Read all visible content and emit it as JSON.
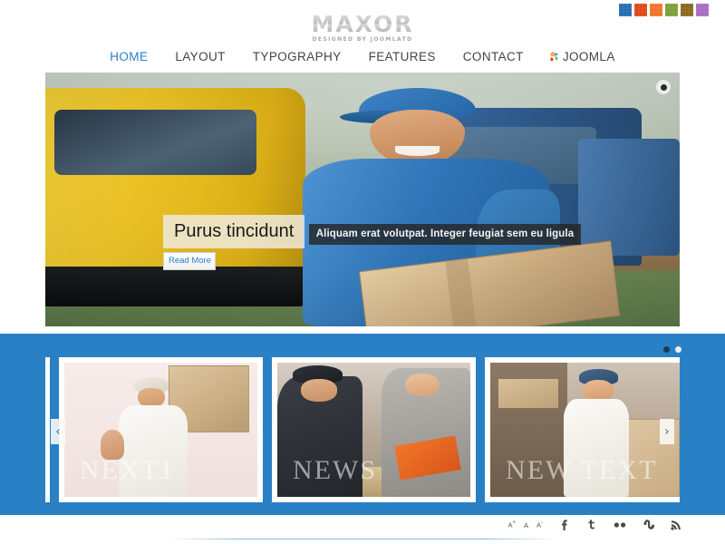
{
  "site": {
    "logo_main": "MAXOR",
    "logo_sub": "DESIGNED BY JOOMLATD"
  },
  "theme_switcher": {
    "name": "color-swatches",
    "colors": [
      "#2a6eb5",
      "#e04a1a",
      "#f2762a",
      "#7ba03c",
      "#8a6a20",
      "#a86ec4"
    ],
    "labels": [
      "blue",
      "red",
      "orange",
      "green",
      "brown",
      "purple"
    ]
  },
  "nav": {
    "items": [
      {
        "label": "HOME",
        "active": true
      },
      {
        "label": "LAYOUT",
        "active": false
      },
      {
        "label": "TYPOGRAPHY",
        "active": false
      },
      {
        "label": "FEATURES",
        "active": false
      },
      {
        "label": "CONTACT",
        "active": false
      },
      {
        "label": "JOOMLA",
        "active": false,
        "icon": "joomla-icon"
      }
    ]
  },
  "slider": {
    "caption_title": "Purus tincidunt",
    "caption_text": "Aliquam erat volutpat. Integer feugiat sem eu ligula",
    "read_more_label": "Read More",
    "play_pause_icon": "pause-dot-icon"
  },
  "carousel": {
    "prev_label": "‹",
    "next_label": "›",
    "pagination": [
      {
        "state": "active"
      },
      {
        "state": "inactive"
      }
    ],
    "items": [
      {
        "name": "thumb-cyclist-courier",
        "watermark": ""
      },
      {
        "name": "thumb-man-with-box",
        "watermark": "NEXT1"
      },
      {
        "name": "thumb-signing-delivery",
        "watermark": "NEWS"
      },
      {
        "name": "thumb-warehouse-worker",
        "watermark": "NEW TEXT"
      }
    ]
  },
  "footer": {
    "font_sizer": [
      {
        "label": "A",
        "sup": "+",
        "name": "font-increase"
      },
      {
        "label": "A",
        "sup": "",
        "name": "font-reset"
      },
      {
        "label": "A",
        "sup": "-",
        "name": "font-decrease"
      }
    ],
    "socials": [
      {
        "name": "facebook-icon",
        "label": "f"
      },
      {
        "name": "twitter-icon",
        "label": "t"
      },
      {
        "name": "flickr-icon",
        "label": "••"
      },
      {
        "name": "stumbleupon-icon",
        "label": "su"
      },
      {
        "name": "rss-icon",
        "label": "rss"
      }
    ]
  },
  "colors": {
    "accent": "#2a80c4",
    "nav_active": "#2a80c4",
    "band": "#2a80c4"
  }
}
